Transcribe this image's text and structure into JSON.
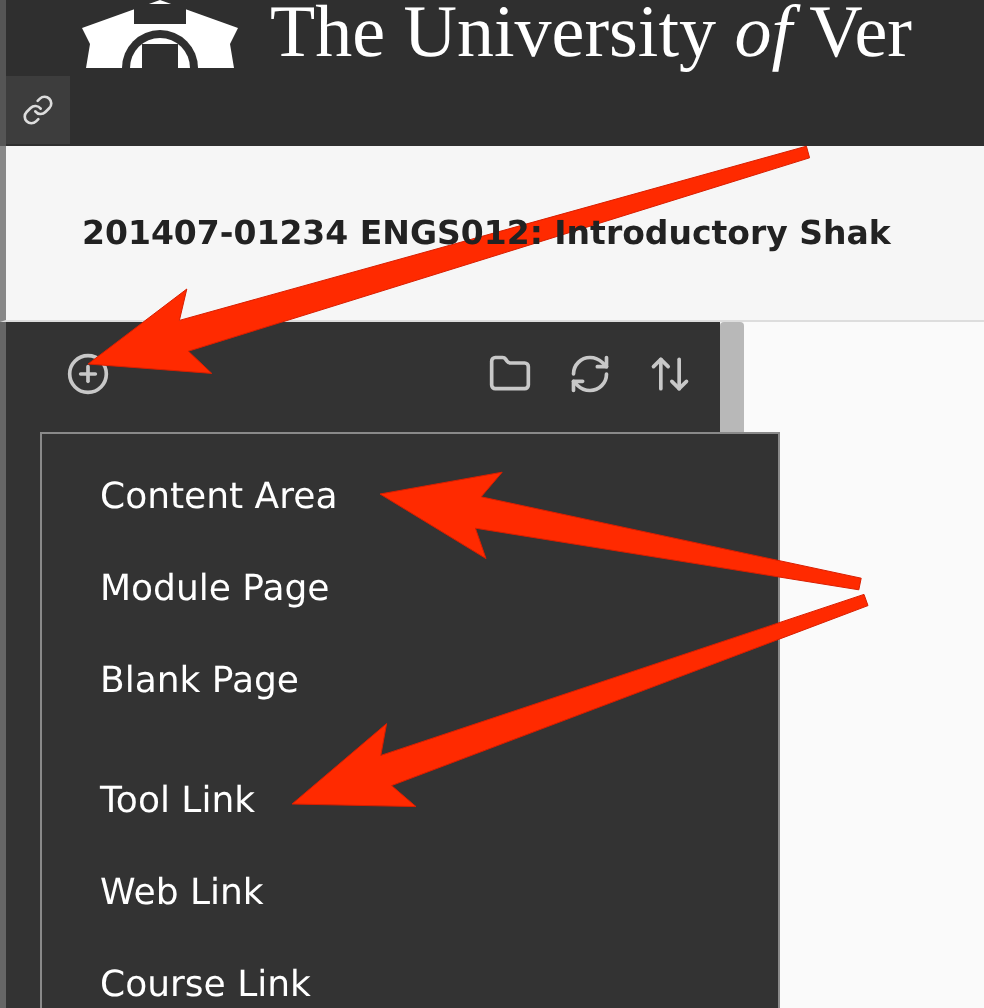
{
  "header": {
    "title": "The University *of* Ver"
  },
  "course_title": "201407-01234 ENGS012: Introductory Shak",
  "menu_groups": [
    {
      "items": [
        "Content Area",
        "Module Page",
        "Blank Page"
      ]
    },
    {
      "items": [
        "Tool Link",
        "Web Link",
        "Course Link"
      ]
    }
  ]
}
